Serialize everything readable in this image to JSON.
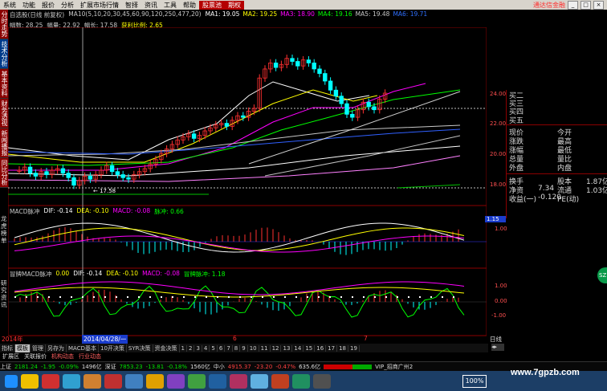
{
  "menu": {
    "items": [
      "系统",
      "功能",
      "报价",
      "分析",
      "扩展市场行情",
      "智择",
      "资讯",
      "工具",
      "帮助"
    ],
    "highlight_items": [
      "股票池",
      "期权"
    ],
    "right_text": "通达信金融"
  },
  "left_tabs": [
    "分时走势",
    "技术分析",
    "基本资料",
    "财务透视",
    "新闻播报",
    "同比分析"
  ],
  "ma_bar": {
    "stock": "自选股(日线 前复权)",
    "ma_params": "MA10(5,10,20,30,45,60,90,120,250,477,20)",
    "values": [
      {
        "label": "MA1: 19.05",
        "color": "#ffffff"
      },
      {
        "label": "MA2: 19.25",
        "color": "#ffff00"
      },
      {
        "label": "MA3: 18.90",
        "color": "#ff00ff"
      },
      {
        "label": "MA4: 19.16",
        "color": "#00ff00"
      },
      {
        "label": "MA5: 19.48",
        "color": "#c8c8c8"
      },
      {
        "label": "MA6: 19.71",
        "color": "#3070ff"
      }
    ],
    "line2": [
      {
        "label": "幅数: 28.25",
        "color": "#c8c8c8"
      },
      {
        "label": "幅量: 22.92",
        "color": "#c8c8c8"
      },
      {
        "label": "幅长: 17.58",
        "color": "#c8c8c8"
      },
      {
        "label": "获利比例: 2.65",
        "color": "#ffff00"
      }
    ]
  },
  "price_axis": [
    "24.00",
    "22.00",
    "20.00",
    "18.00"
  ],
  "low_marker": "17.58",
  "right_panel": {
    "bid_ask": [
      "买二",
      "买三",
      "买四",
      "买五"
    ],
    "rows": [
      [
        "现价",
        "",
        "今开",
        ""
      ],
      [
        "涨跌",
        "",
        "最高",
        ""
      ],
      [
        "涨幅",
        "",
        "最低",
        ""
      ],
      [
        "总量",
        "",
        "量比",
        ""
      ],
      [
        "外盘",
        "",
        "内盘",
        ""
      ]
    ],
    "rows2": [
      [
        "换手",
        "",
        "股本",
        "1.87亿"
      ],
      [
        "净资",
        "7.34",
        "流通",
        "1.03亿"
      ],
      [
        "收益(一)",
        "-0.120",
        "PE(动)",
        ""
      ]
    ]
  },
  "ind1": {
    "title": "MACD脉冲",
    "values": [
      {
        "label": "DIF: -0.14",
        "color": "#ffffff"
      },
      {
        "label": "DEA: -0.10",
        "color": "#ffff00"
      },
      {
        "label": "MACD: -0.08",
        "color": "#ff00ff"
      },
      {
        "label": "脉冲: 0.66",
        "color": "#00ff00"
      }
    ],
    "side": [
      "龙",
      "虎",
      "榜",
      "单"
    ],
    "axis": [
      "1.15",
      "1.00"
    ]
  },
  "ind2": {
    "title": "冒牌MACD脉冲",
    "values": [
      {
        "label": "0.00",
        "color": "#ffff00"
      },
      {
        "label": "DIF: -0.14",
        "color": "#ffffff"
      },
      {
        "label": "DEA: -0.10",
        "color": "#ffff00"
      },
      {
        "label": "MACD: -0.08",
        "color": "#ff00ff"
      },
      {
        "label": "冒牌脉冲: 1.18",
        "color": "#00ff00"
      }
    ],
    "side": [
      "研",
      "究",
      "资",
      "讯"
    ],
    "axis": [
      "1.00",
      "0.00",
      "-1.00"
    ]
  },
  "date_bar": {
    "year": "2014年",
    "date": "2014/04/28/一",
    "m6": "6",
    "m7": "7",
    "right": "日线"
  },
  "bottom_tabs": [
    "指标",
    "模板",
    "管理",
    "另存为",
    "MACD基本",
    "10开决策",
    "SYR决策",
    "资金决策",
    "1",
    "2",
    "3",
    "4",
    "5",
    "6",
    "7",
    "8",
    "9",
    "10",
    "11",
    "12",
    "13",
    "14",
    "15",
    "16",
    "17",
    "18",
    "19"
  ],
  "index_tabs": [
    "扩展区",
    "关联报价",
    "机构动态",
    "行业动态"
  ],
  "status": {
    "sh_label": "上证",
    "sh_val": "2181.24",
    "sh_chg": "-1.95",
    "sh_pct": "-0.09%",
    "sh_amt": "1496亿",
    "sz_label": "深证",
    "sz_val": "7853.23",
    "sz_chg": "-13.81",
    "sz_pct": "-0.18%",
    "sz_amt": "1560亿",
    "zx_label": "中小",
    "zx_val": "4915.37",
    "zx_chg": "-23.20",
    "zx_pct": "-0.47%",
    "zx_amt": "635.6亿",
    "vip": "VIP_招商广州2"
  },
  "taskbar": {
    "zoom": "100%"
  },
  "watermark": "www.7gpzb.com"
}
